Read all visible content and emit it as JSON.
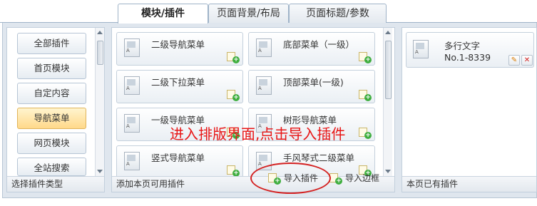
{
  "tabs": [
    {
      "label": "模块/插件",
      "active": true
    },
    {
      "label": "页面背景/布局",
      "active": false
    },
    {
      "label": "页面标题/参数",
      "active": false
    }
  ],
  "categories": {
    "items": [
      "全部插件",
      "首页模块",
      "自定内容",
      "导航菜单",
      "网页模块",
      "全站搜索"
    ],
    "selected": "导航菜单",
    "footer": "选择插件类型"
  },
  "plugins": {
    "items": [
      "二级导航菜单",
      "底部菜单（一级）",
      "二级下拉菜单",
      "顶部菜单(一级)",
      "一级导航菜单",
      "树形导航菜单",
      "竖式导航菜单",
      "手风琴式二级菜单"
    ],
    "footer": "添加本页可用插件",
    "import_plugin": "导入插件",
    "import_border": "导入边框"
  },
  "annotation": "进入排版界面,点击导入插件",
  "existing": {
    "title": "多行文字",
    "number": "No.1-8339",
    "footer": "本页已有插件"
  },
  "colors": {
    "annotation": "#e81515",
    "selected_category": "#ffd98a",
    "frame_bg": "#dfe6ee"
  }
}
